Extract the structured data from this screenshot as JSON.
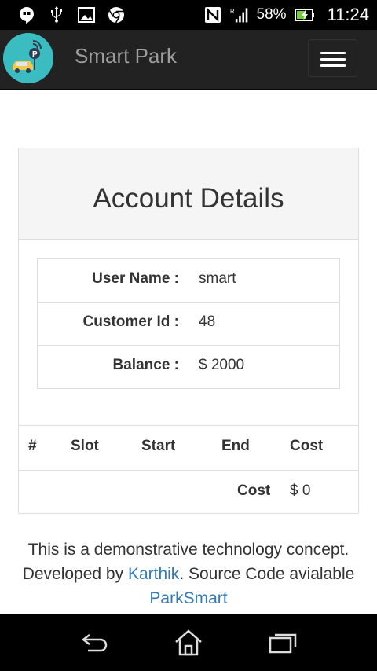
{
  "status_bar": {
    "battery": "58%",
    "time": "11:24",
    "icons": [
      "hangouts-icon",
      "usb-icon",
      "gallery-icon",
      "chrome-icon",
      "nfc-icon",
      "signal-icon",
      "battery-icon"
    ]
  },
  "navbar": {
    "brand": "Smart Park",
    "logo_icon": "parking-car-logo-icon",
    "menu_icon": "hamburger-menu-icon"
  },
  "account": {
    "title": "Account Details",
    "rows": [
      {
        "label": "User Name :",
        "value": "smart"
      },
      {
        "label": "Customer Id :",
        "value": "48"
      },
      {
        "label": "Balance :",
        "value": "$ 2000"
      }
    ]
  },
  "bookings": {
    "headers": [
      "#",
      "Slot",
      "Start",
      "End",
      "Cost"
    ],
    "total_label": "Cost",
    "total_value": "$ 0"
  },
  "footer": {
    "text1": "This is a demonstrative technology concept. Developed by ",
    "link1": "Karthik",
    "text2": ". Source Code avialable ",
    "link2": "ParkSmart"
  },
  "system_nav": {
    "icons": [
      "back-icon",
      "home-icon",
      "recent-apps-icon"
    ]
  },
  "colors": {
    "navbar_bg": "#222222",
    "logo_bg": "#3bbcc0",
    "link": "#337ab7",
    "panel_heading": "#f5f5f5"
  }
}
